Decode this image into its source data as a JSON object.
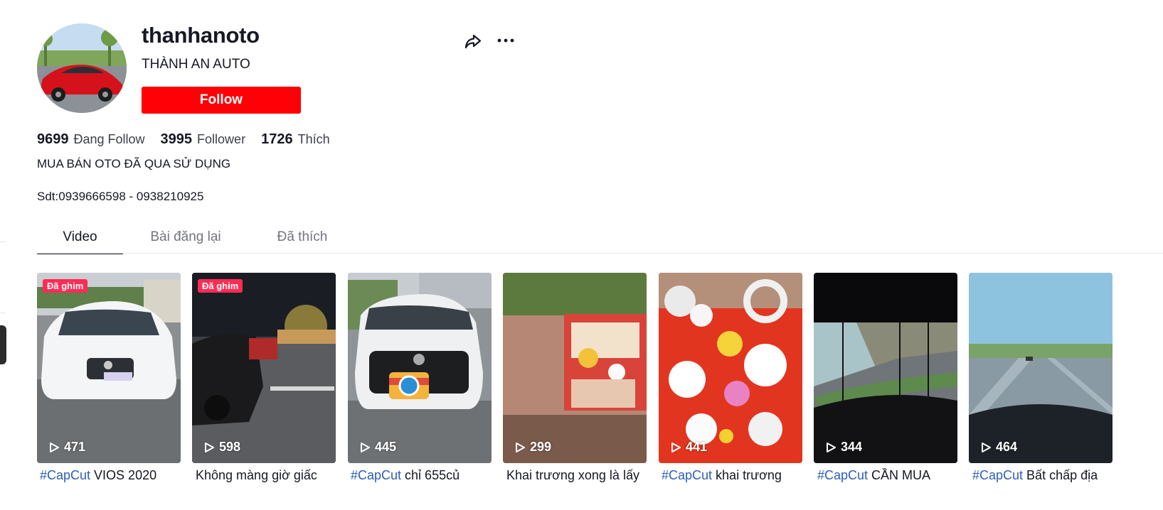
{
  "profile": {
    "username": "thanhanoto",
    "nickname": "THÀNH AN AUTO",
    "follow_label": "Follow",
    "stats": [
      {
        "value": "9699",
        "label": "Đang Follow"
      },
      {
        "value": "3995",
        "label": "Follower"
      },
      {
        "value": "1726",
        "label": "Thích"
      }
    ],
    "bio_line1": "MUA BÁN OTO ĐÃ QUA SỬ DỤNG",
    "bio_line2": "Sdt:0939666598 - 0938210925"
  },
  "icons": {
    "share": "share-icon",
    "more": "more-horizontal-icon"
  },
  "colors": {
    "follow_button": "#fe0006",
    "pinned_badge": "#fe2c55",
    "hashtag": "#2b5db9"
  },
  "tabs": [
    {
      "label": "Video",
      "active": true
    },
    {
      "label": "Bài đăng lại",
      "active": false
    },
    {
      "label": "Đã thích",
      "active": false
    }
  ],
  "videos": [
    {
      "pinned": "Đã ghim",
      "views": "471",
      "hashtag": "#CapCut",
      "caption": "VIOS 2020"
    },
    {
      "pinned": "Đã ghim",
      "views": "598",
      "hashtag": "",
      "caption": "Không màng giờ giấc"
    },
    {
      "pinned": "",
      "views": "445",
      "hashtag": "#CapCut",
      "caption": "chỉ 655củ"
    },
    {
      "pinned": "",
      "views": "299",
      "hashtag": "",
      "caption": "Khai trương xong là lấy"
    },
    {
      "pinned": "",
      "views": "441",
      "hashtag": "#CapCut",
      "caption": "khai trương"
    },
    {
      "pinned": "",
      "views": "344",
      "hashtag": "#CapCut",
      "caption": "CẦN MUA"
    },
    {
      "pinned": "",
      "views": "464",
      "hashtag": "#CapCut",
      "caption": "Bất chấp địa"
    }
  ]
}
